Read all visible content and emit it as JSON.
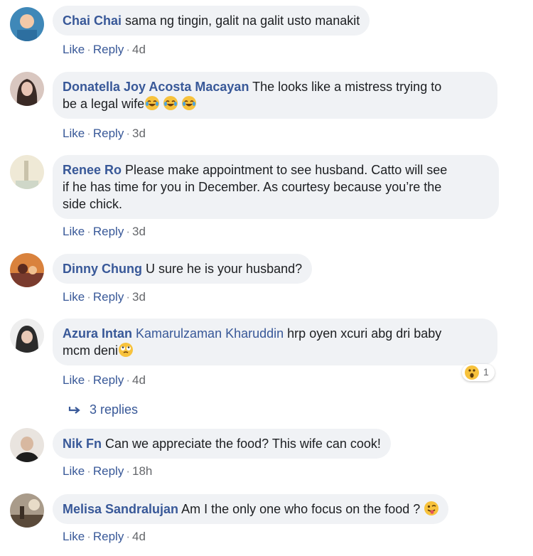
{
  "actions": {
    "like": "Like",
    "reply": "Reply"
  },
  "comments": [
    {
      "author": "Chai Chai",
      "text": "sama ng tingin, galit na galit usto manakit",
      "time": "4d",
      "avatar_colors": [
        "#2d6fa0",
        "#f2c9a8"
      ]
    },
    {
      "author": "Donatella Joy Acosta Macayan",
      "text": "The looks like a mistress trying to",
      "text2": "be a legal wife",
      "time": "3d",
      "emoji": [
        "joy",
        "joy",
        "joy"
      ],
      "avatar_colors": [
        "#3a2a25",
        "#e8c4b4"
      ]
    },
    {
      "author": "Renee Ro",
      "text": "Please make appointment to see husband. Catto will see",
      "text2": "if he has time for you in December. As courtesy because you’re the",
      "text3": "side chick.",
      "time": "3d",
      "avatar_colors": [
        "#cfd7c8",
        "#efe9d6"
      ]
    },
    {
      "author": "Dinny Chung",
      "text": "U sure he is your husband?",
      "time": "3d",
      "avatar_colors": [
        "#7a3b2e",
        "#d9823d"
      ]
    },
    {
      "author": "Azura Intan",
      "mention": "Kamarulzaman Kharuddin",
      "text": "hrp oyen xcuri abg dri baby",
      "text2": "mcm deni",
      "time": "4d",
      "emoji": [
        "rolling-eyes"
      ],
      "reaction": {
        "icon": "wow",
        "count": "1"
      },
      "avatar_colors": [
        "#2b2b2b",
        "#e9c9b6"
      ]
    },
    {
      "author": "Nik Fn",
      "text": "Can we appreciate the food? This wife can cook!",
      "time": "18h",
      "avatar_colors": [
        "#e9e4df",
        "#1d1d1d"
      ]
    },
    {
      "author": "Melisa Sandralujan",
      "text": "Am I the only one who focus on the food ?",
      "time": "4d",
      "emoji": [
        "tongue-wink"
      ],
      "avatar_colors": [
        "#5a4a3a",
        "#a99b8a"
      ]
    }
  ],
  "replies_label": "3 replies",
  "colors": {
    "name": "#385898",
    "bubble": "#f0f2f5",
    "meta": "#65676b"
  }
}
